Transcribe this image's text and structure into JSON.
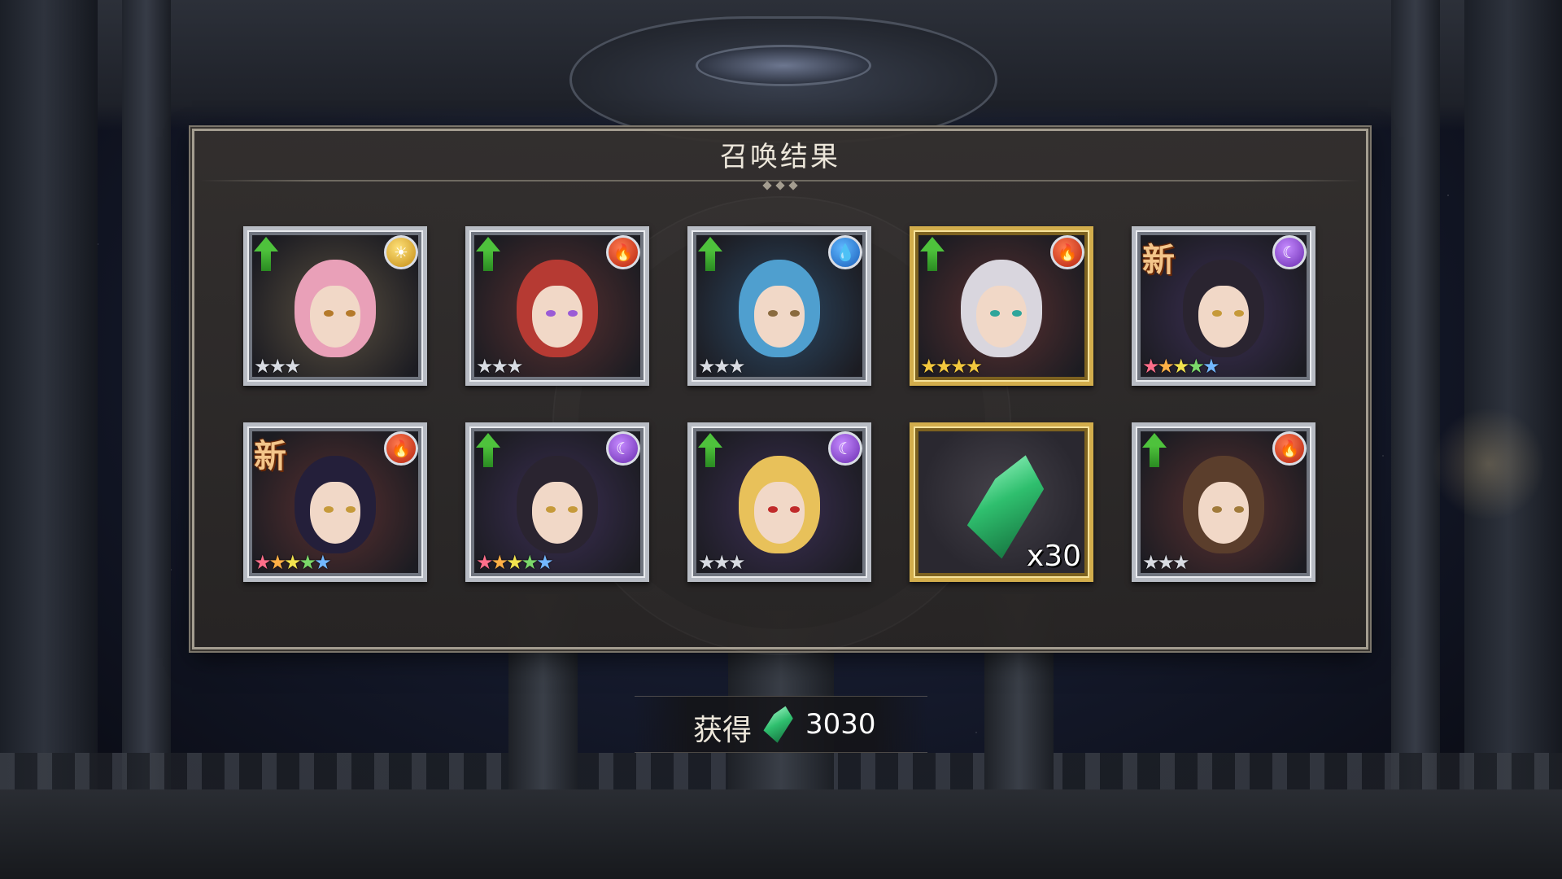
{
  "panel": {
    "title": "召唤结果"
  },
  "results": [
    {
      "badge": "up",
      "element": "light",
      "element_icon": "☀",
      "rarity": 3,
      "star_style": "silver",
      "hair": "#e9a0b8",
      "eye": "#b57a2b"
    },
    {
      "badge": "up",
      "element": "fire",
      "element_icon": "🔥",
      "rarity": 3,
      "star_style": "silver",
      "hair": "#b63a33",
      "eye": "#9b5bd6"
    },
    {
      "badge": "up",
      "element": "water",
      "element_icon": "💧",
      "rarity": 3,
      "star_style": "silver",
      "hair": "#4f9fcf",
      "eye": "#8a6b3f"
    },
    {
      "badge": "up",
      "element": "fire",
      "element_icon": "🔥",
      "rarity": 4,
      "star_style": "gold",
      "hair": "#d9d6de",
      "eye": "#2fa59b",
      "frame": "gold"
    },
    {
      "badge": "new",
      "badge_text": "新",
      "element": "dark",
      "element_icon": "☾",
      "rarity": 5,
      "star_style": "rainbow",
      "hair": "#2a2430",
      "eye": "#c69a3a"
    },
    {
      "badge": "new",
      "badge_text": "新",
      "element": "fire",
      "element_icon": "🔥",
      "rarity": 5,
      "star_style": "rainbow",
      "hair": "#241f3a",
      "eye": "#c69a3a"
    },
    {
      "badge": "up",
      "element": "dark",
      "element_icon": "☾",
      "rarity": 5,
      "star_style": "rainbow",
      "hair": "#2a2430",
      "eye": "#c69a3a"
    },
    {
      "badge": "up",
      "element": "dark",
      "element_icon": "☾",
      "rarity": 3,
      "star_style": "silver",
      "hair": "#e8c15a",
      "eye": "#c02a2a"
    },
    {
      "item": "crystal",
      "quantity": "x30",
      "frame": "gold"
    },
    {
      "badge": "up",
      "element": "fire",
      "element_icon": "🔥",
      "rarity": 3,
      "star_style": "silver",
      "hair": "#5b3e2c",
      "eye": "#a07a3a"
    }
  ],
  "obtain": {
    "label": "获得",
    "icon": "green-crystal-icon",
    "value": "3030"
  }
}
